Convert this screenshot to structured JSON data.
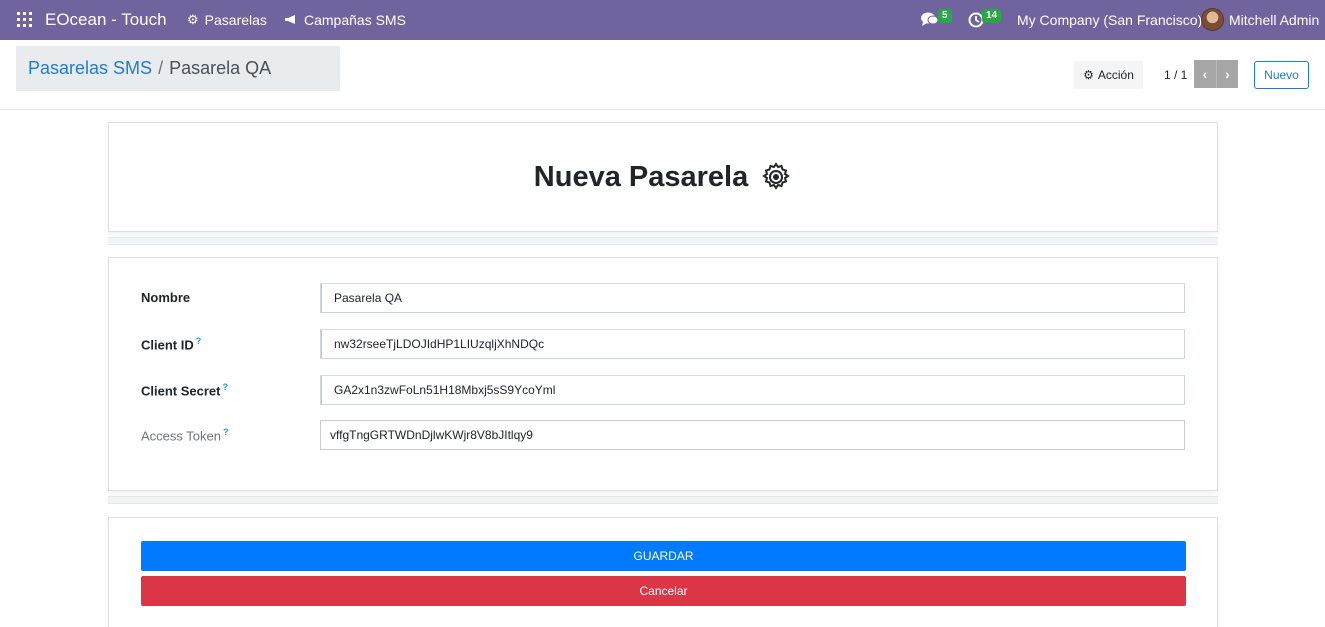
{
  "navbar": {
    "app_title": "EOcean - Touch",
    "menu": [
      {
        "label": "Pasarelas",
        "icon": "gear-icon"
      },
      {
        "label": "Campañas SMS",
        "icon": "megaphone-icon"
      }
    ],
    "messages_count": "5",
    "activities_count": "14",
    "company": "My Company (San Francisco)",
    "user": "Mitchell Admin",
    "color": "#71639e"
  },
  "breadcrumb": {
    "parent": "Pasarelas SMS",
    "separator": "/",
    "current": "Pasarela QA"
  },
  "controls": {
    "action_label": "Acción",
    "pager": "1 / 1",
    "new_label": "Nuevo"
  },
  "form": {
    "title": "Nueva Pasarela",
    "fields": [
      {
        "label": "Nombre",
        "help": "",
        "value": "Pasarela QA"
      },
      {
        "label": "Client ID",
        "help": "?",
        "value": "nw32rseeTjLDOJIdHP1LIUzqljXhNDQc"
      },
      {
        "label": "Client Secret",
        "help": "?",
        "value": "GA2x1n3zwFoLn51H18Mbxj5sS9YcoYml"
      },
      {
        "label": "Access Token",
        "help": "?",
        "value": "vffgTngGRTWDnDjlwKWjr8V8bJItlqy9"
      }
    ],
    "save_label": "GUARDAR",
    "cancel_label": "Cancelar"
  },
  "colors": {
    "primary": "#007bff",
    "danger": "#dc3545",
    "badge": "#28a745",
    "link": "#1f7ad8"
  }
}
